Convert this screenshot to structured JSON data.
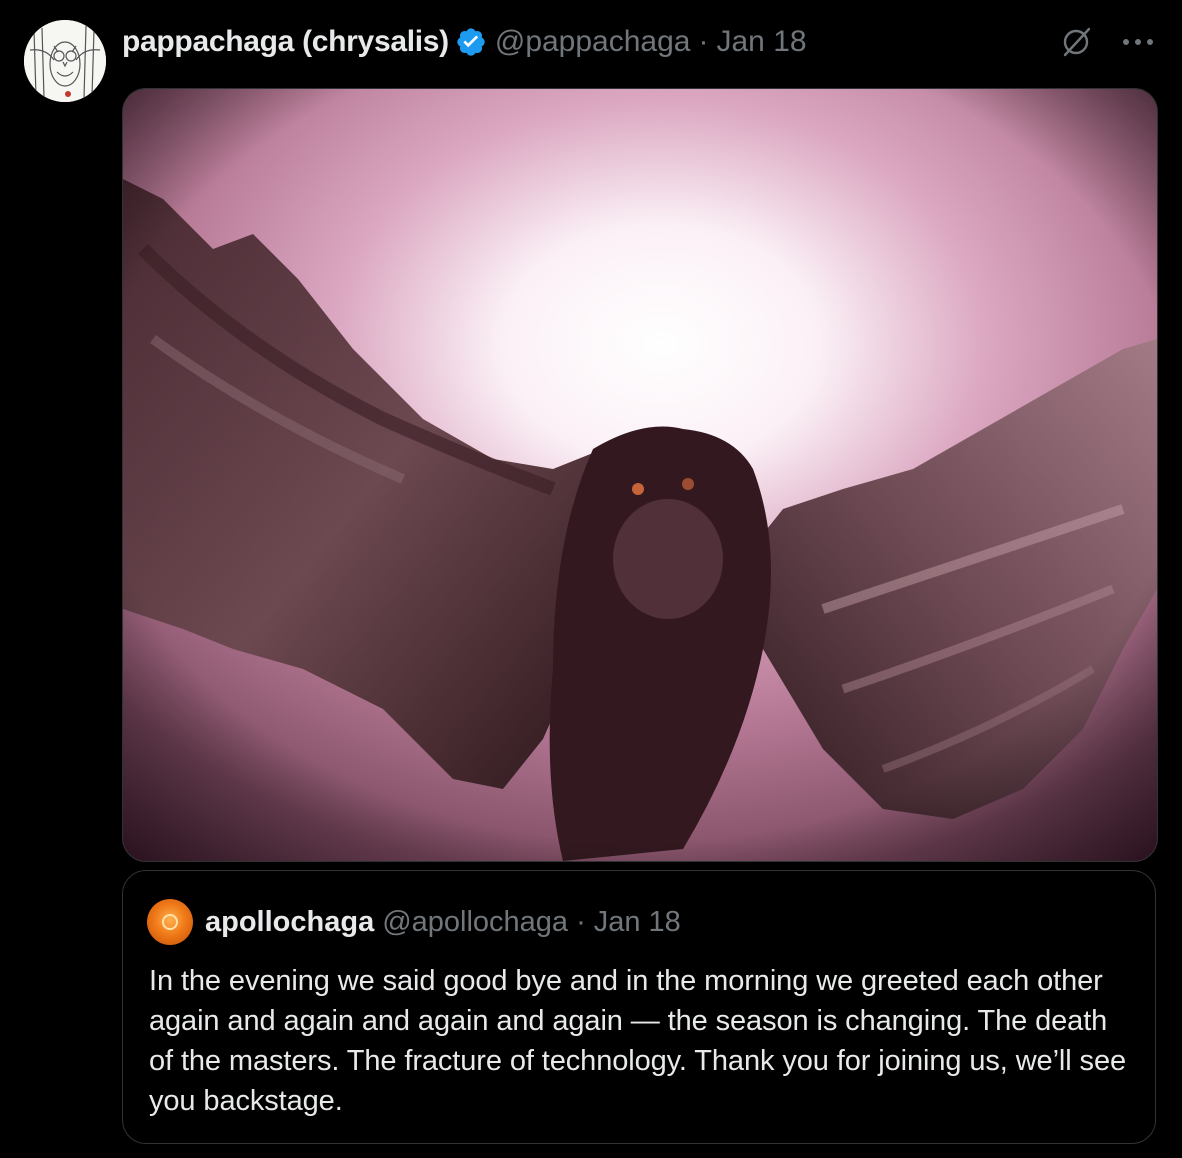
{
  "tweet": {
    "display_name": "pappachaga (chrysalis)",
    "handle": "@pappachaga",
    "separator": "·",
    "date": "Jan 18",
    "grok_icon": "grok-slash-icon",
    "more_icon": "more-dots-icon",
    "verified_icon": "verified-badge-icon",
    "colors": {
      "background": "#000000",
      "name": "#e7e9ea",
      "secondary": "#71767b",
      "verified": "#1d9bf0",
      "border": "#2f3336"
    }
  },
  "media": {
    "icon": "owl-photo"
  },
  "quote": {
    "display_name": "apollochaga",
    "handle": "@apollochaga",
    "separator": "·",
    "date": "Jan 18",
    "text": "In the evening we said good bye and in the morning we greeted each other again and again and again and again — the season is changing. The death of the masters. The fracture of technology. Thank you for joining us, we’ll see you backstage."
  }
}
